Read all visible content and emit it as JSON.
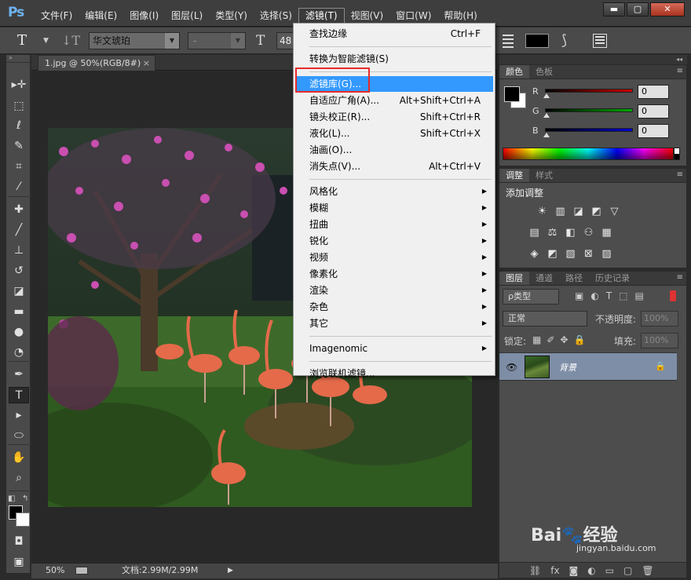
{
  "app": {
    "logo": "Ps"
  },
  "menubar": {
    "items": [
      "文件(F)",
      "编辑(E)",
      "图像(I)",
      "图层(L)",
      "类型(Y)",
      "选择(S)",
      "滤镜(T)",
      "视图(V)",
      "窗口(W)",
      "帮助(H)"
    ],
    "active_index": 6,
    "window_controls": {
      "minimize": "▬",
      "maximize": "▢",
      "close": "✕"
    }
  },
  "options_bar": {
    "tool_glyph": "T",
    "orient_glyph": "↓T",
    "font_family": "华文琥珀",
    "font_style": "-",
    "size_glyph": "T",
    "font_size": "48"
  },
  "document": {
    "tab_title": "1.jpg @ 50%(RGB/8#)",
    "tab_close": "×",
    "zoom": "50%",
    "info": "文档:2.99M/2.99M"
  },
  "toolbox": {
    "tools": [
      {
        "name": "move-tool",
        "glyph": "▸✛"
      },
      {
        "name": "marquee-tool",
        "glyph": "⬚"
      },
      {
        "name": "lasso-tool",
        "glyph": "ℓ"
      },
      {
        "name": "quick-select-tool",
        "glyph": "✎"
      },
      {
        "name": "crop-tool",
        "glyph": "⌗"
      },
      {
        "name": "eyedropper-tool",
        "glyph": "⁄"
      },
      {
        "name": "healing-tool",
        "glyph": "✚"
      },
      {
        "name": "brush-tool",
        "glyph": "╱"
      },
      {
        "name": "stamp-tool",
        "glyph": "⊥"
      },
      {
        "name": "history-brush-tool",
        "glyph": "↺"
      },
      {
        "name": "eraser-tool",
        "glyph": "◪"
      },
      {
        "name": "gradient-tool",
        "glyph": "▬"
      },
      {
        "name": "blur-tool",
        "glyph": "●"
      },
      {
        "name": "dodge-tool",
        "glyph": "◔"
      },
      {
        "name": "pen-tool",
        "glyph": "✒"
      },
      {
        "name": "type-tool",
        "glyph": "T"
      },
      {
        "name": "path-select-tool",
        "glyph": "▸"
      },
      {
        "name": "shape-tool",
        "glyph": "⬭"
      },
      {
        "name": "hand-tool",
        "glyph": "✋"
      },
      {
        "name": "zoom-tool",
        "glyph": "⌕"
      }
    ],
    "selected": "type-tool",
    "quickmask_glyph": "◘",
    "screenmode_glyph": "▣"
  },
  "color_panel": {
    "tabs": [
      "颜色",
      "色板"
    ],
    "sliders": [
      {
        "label": "R",
        "value": "0",
        "color": "#cc0000"
      },
      {
        "label": "G",
        "value": "0",
        "color": "#00aa00"
      },
      {
        "label": "B",
        "value": "0",
        "color": "#0000cc"
      }
    ]
  },
  "adjust_panel": {
    "tabs": [
      "调整",
      "样式"
    ],
    "title": "添加调整",
    "rows": [
      [
        "☀",
        "▥",
        "◪",
        "◩",
        "▽"
      ],
      [
        "▤",
        "⚖",
        "◧",
        "⚇",
        "▦"
      ],
      [
        "◈",
        "◩",
        "▧",
        "⊠",
        "▨"
      ]
    ]
  },
  "layers_panel": {
    "tabs": [
      "图层",
      "通道",
      "路径",
      "历史记录"
    ],
    "filter": "ρ类型",
    "filter_icons": [
      "▣",
      "◐",
      "T",
      "⬚",
      "▤"
    ],
    "blend_mode": "正常",
    "opacity_label": "不透明度:",
    "opacity": "100%",
    "lock_label": "锁定:",
    "lock_icons": [
      "▦",
      "✐",
      "✥",
      "🔒"
    ],
    "fill_label": "填充:",
    "fill": "100%",
    "layer_name": "背景",
    "footer_icons": [
      "⛓",
      "fx",
      "◙",
      "◐",
      "▭",
      "▢",
      "🗑"
    ]
  },
  "filter_menu": {
    "items": [
      {
        "label": "查找边缘",
        "shortcut": "Ctrl+F"
      },
      {
        "sep": true
      },
      {
        "label": "转换为智能滤镜(S)"
      },
      {
        "sep": true
      },
      {
        "label": "滤镜库(G)...",
        "highlight": true
      },
      {
        "label": "自适应广角(A)...",
        "shortcut": "Alt+Shift+Ctrl+A"
      },
      {
        "label": "镜头校正(R)...",
        "shortcut": "Shift+Ctrl+R"
      },
      {
        "label": "液化(L)...",
        "shortcut": "Shift+Ctrl+X"
      },
      {
        "label": "油画(O)..."
      },
      {
        "label": "消失点(V)...",
        "shortcut": "Alt+Ctrl+V"
      },
      {
        "sep": true
      },
      {
        "label": "风格化",
        "sub": true
      },
      {
        "label": "模糊",
        "sub": true
      },
      {
        "label": "扭曲",
        "sub": true
      },
      {
        "label": "锐化",
        "sub": true
      },
      {
        "label": "视频",
        "sub": true
      },
      {
        "label": "像素化",
        "sub": true
      },
      {
        "label": "渲染",
        "sub": true
      },
      {
        "label": "杂色",
        "sub": true
      },
      {
        "label": "其它",
        "sub": true
      },
      {
        "sep": true
      },
      {
        "label": "Imagenomic",
        "sub": true
      },
      {
        "sep": true
      },
      {
        "label": "浏览联机滤镜..."
      }
    ]
  },
  "watermark": {
    "logo": "Bai🐾经验",
    "url": "jingyan.baidu.com"
  }
}
